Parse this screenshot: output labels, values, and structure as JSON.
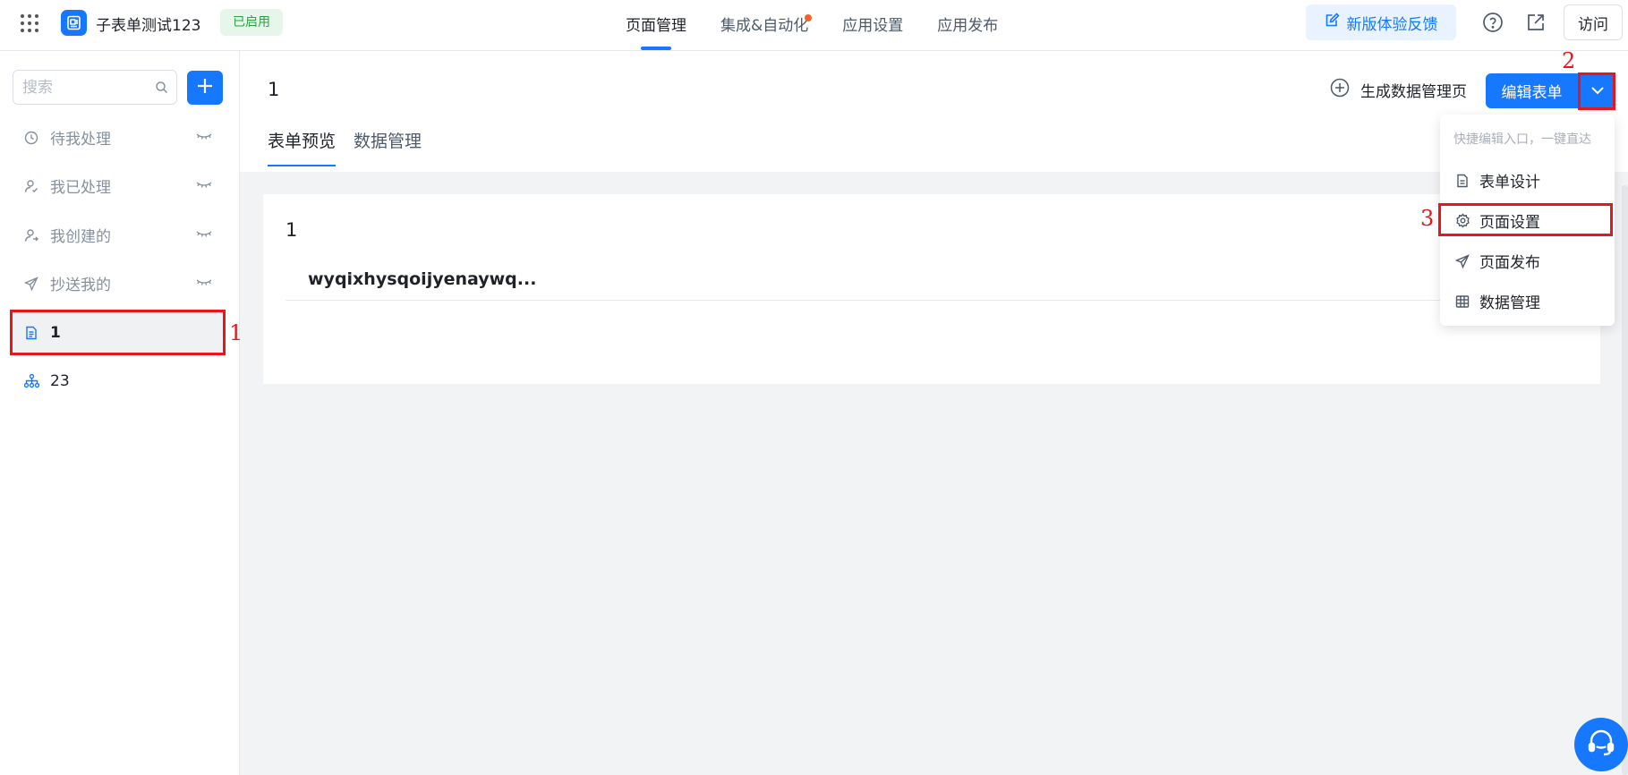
{
  "header": {
    "app_title": "子表单测试123",
    "status_badge": "已启用",
    "nav": [
      {
        "label": "页面管理",
        "active": true
      },
      {
        "label": "集成&自动化",
        "has_dot": true
      },
      {
        "label": "应用设置"
      },
      {
        "label": "应用发布"
      }
    ],
    "feedback_label": "新版体验反馈",
    "visit_label": "访问"
  },
  "sidebar": {
    "search_placeholder": "搜索",
    "items": [
      {
        "label": "待我处理",
        "icon": "clock-icon"
      },
      {
        "label": "我已处理",
        "icon": "user-check-icon"
      },
      {
        "label": "我创建的",
        "icon": "user-add-icon"
      },
      {
        "label": "抄送我的",
        "icon": "send-icon"
      },
      {
        "label": "1",
        "icon": "form-doc-icon",
        "selected": true
      },
      {
        "label": "23",
        "icon": "org-chart-icon"
      }
    ]
  },
  "main": {
    "page_name": "1",
    "tabs": [
      {
        "label": "表单预览",
        "active": true
      },
      {
        "label": "数据管理"
      }
    ],
    "generate_link": "生成数据管理页",
    "edit_button": "编辑表单",
    "card": {
      "title": "1",
      "field_value": "wyqixhysqoijyenaywq..."
    }
  },
  "dropdown_menu": {
    "hint": "快捷编辑入口，一键直达",
    "items": [
      {
        "label": "表单设计",
        "icon": "document-icon"
      },
      {
        "label": "页面设置",
        "icon": "gear-icon"
      },
      {
        "label": "页面发布",
        "icon": "send-icon"
      },
      {
        "label": "数据管理",
        "icon": "table-icon"
      }
    ]
  },
  "annotations": [
    "1",
    "2",
    "3"
  ],
  "colors": {
    "accent": "#1677ff",
    "annotation_red": "#e8151b",
    "badge_green": "#2ba245"
  }
}
